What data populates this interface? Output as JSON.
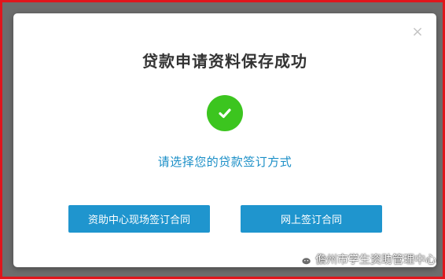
{
  "dialog": {
    "close_label": "×",
    "title": "贷款申请资料保存成功",
    "success_icon": "check-circle-icon",
    "subtitle": "请选择您的贷款签订方式",
    "buttons": {
      "onsite": "资助中心现场签订合同",
      "online": "网上签订合同"
    }
  },
  "watermark": {
    "icon": "wechat-icon",
    "text": "儋州市学生资助管理中心"
  },
  "colors": {
    "overlay": "#6d6d6d",
    "frame_border": "#e0161c",
    "success_green": "#3cc51f",
    "accent_blue": "#1f95ce",
    "subtitle_blue": "#1b8fc7",
    "title_text": "#333333"
  }
}
